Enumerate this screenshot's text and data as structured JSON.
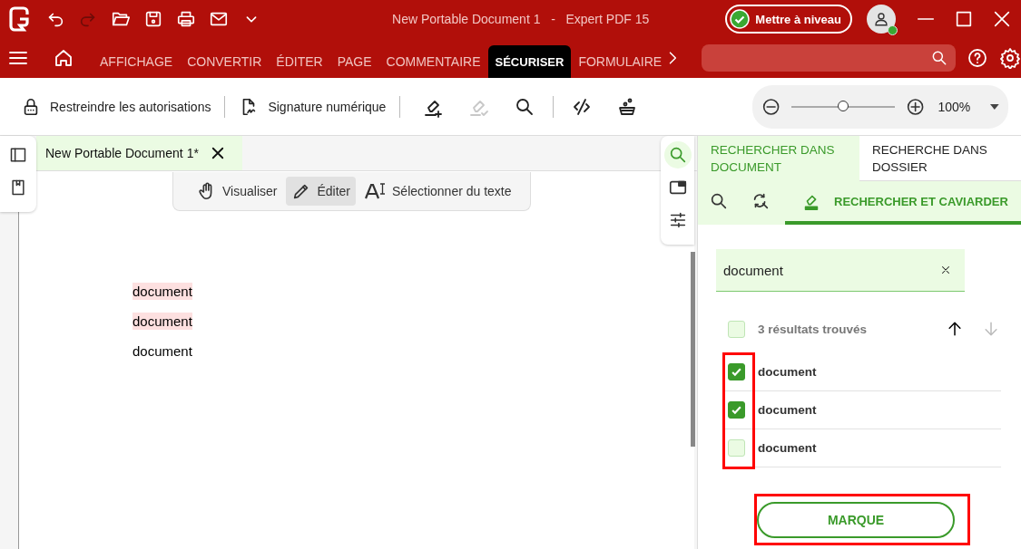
{
  "app_bar": {
    "title": "New Portable Document 1   -   Expert PDF 15",
    "upgrade_button": "Mettre à niveau",
    "quick_actions": [
      {
        "kind": "undo",
        "disabled": false
      },
      {
        "kind": "redo",
        "disabled": true
      },
      {
        "kind": "open",
        "disabled": false
      },
      {
        "kind": "save",
        "disabled": false
      },
      {
        "kind": "print",
        "disabled": false
      },
      {
        "kind": "mail",
        "disabled": false
      },
      {
        "kind": "more",
        "disabled": false
      }
    ]
  },
  "ribbon_tabs": [
    {
      "label": "AFFICHAGE",
      "selected": false
    },
    {
      "label": "CONVERTIR",
      "selected": false
    },
    {
      "label": "ÉDITER",
      "selected": false
    },
    {
      "label": "PAGE",
      "selected": false
    },
    {
      "label": "COMMENTAIRE",
      "selected": false
    },
    {
      "label": "SÉCURISER",
      "selected": true
    },
    {
      "label": "FORMULAIRE",
      "selected": false
    }
  ],
  "toolbar": {
    "buttons": [
      {
        "kind": "lock",
        "label": "Restreindre les autorisations"
      },
      {
        "kind": "signature",
        "label": "Signature numérique"
      }
    ],
    "tools": [
      {
        "kind": "mark-redaction",
        "disabled": false
      },
      {
        "kind": "apply-redaction",
        "disabled": true
      },
      {
        "kind": "search",
        "disabled": false
      },
      {
        "kind": "unlink",
        "disabled": false
      },
      {
        "kind": "clean",
        "disabled": false
      }
    ]
  },
  "zoom": {
    "level": 0.5,
    "value": "100%"
  },
  "document_tab": {
    "title": "New Portable Document 1*"
  },
  "view_modes": [
    {
      "kind": "hand",
      "label": "Visualiser",
      "selected": false
    },
    {
      "kind": "pencil",
      "label": "Éditer",
      "selected": true
    },
    {
      "kind": "text",
      "label": "Sélectionner du texte",
      "selected": false
    }
  ],
  "left_rail": [
    {
      "kind": "sidebar",
      "selected": false
    },
    {
      "kind": "bookmark",
      "selected": false
    }
  ],
  "right_rail": [
    {
      "kind": "search",
      "selected": true
    },
    {
      "kind": "panel",
      "selected": false
    },
    {
      "kind": "sliders",
      "selected": false
    }
  ],
  "page_lines": [
    {
      "text": "document",
      "marked": true
    },
    {
      "text": "document",
      "marked": true
    },
    {
      "text": "document",
      "marked": false
    }
  ],
  "panel": {
    "tabs": [
      {
        "label": "RECHERCHER DANS DOCUMENT",
        "selected": true
      },
      {
        "label": "RECHERCHE DANS DOSSIER",
        "selected": false
      }
    ],
    "modes": [
      {
        "kind": "search",
        "selected": false
      },
      {
        "kind": "replace",
        "selected": false
      },
      {
        "kind": "redact",
        "label": "RECHERCHER ET CAVIARDER",
        "selected": true
      }
    ],
    "search_value": "document",
    "result_count": "3 résultats trouvés",
    "select_all_checked": false,
    "results_highlighted": true,
    "results": [
      {
        "text": "document",
        "checked": true
      },
      {
        "text": "document",
        "checked": true
      },
      {
        "text": "document",
        "checked": false
      }
    ],
    "mark_button": {
      "label": "MARQUE",
      "highlighted": true
    }
  }
}
